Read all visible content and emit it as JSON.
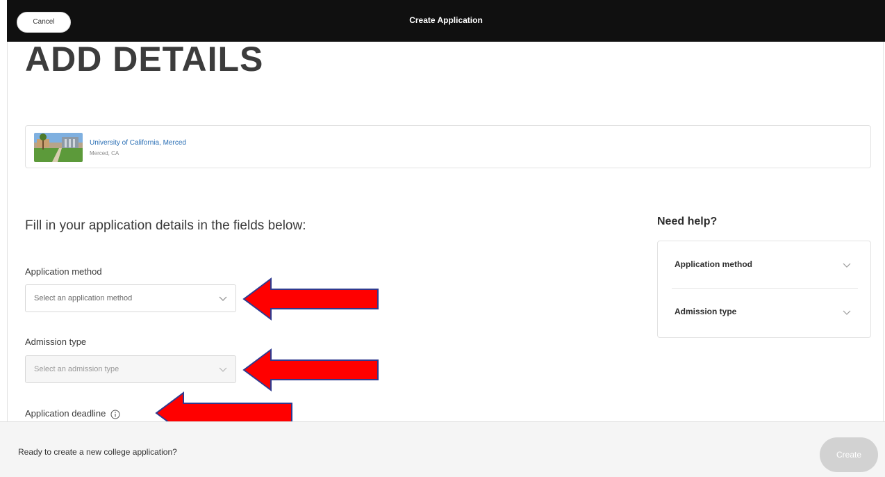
{
  "topbar": {
    "cancel_label": "Cancel",
    "title": "Create Application"
  },
  "page": {
    "heading": "ADD DETAILS",
    "intro": "Fill in your application details in the fields below:"
  },
  "school": {
    "name": "University of California, Merced",
    "location": "Merced, CA"
  },
  "form": {
    "application_method": {
      "label": "Application method",
      "placeholder": "Select an application method"
    },
    "admission_type": {
      "label": "Admission type",
      "placeholder": "Select an admission type"
    },
    "application_deadline": {
      "label": "Application deadline"
    }
  },
  "help": {
    "title": "Need help?",
    "items": [
      {
        "label": "Application method"
      },
      {
        "label": "Admission type"
      }
    ]
  },
  "bottombar": {
    "prompt": "Ready to create a new college application?",
    "create_label": "Create"
  },
  "colors": {
    "topbar": "#101010",
    "link": "#2a6fb5",
    "arrow_fill": "#ff0000",
    "arrow_stroke": "#2f3a8f",
    "create_disabled": "#d2d2d2"
  }
}
